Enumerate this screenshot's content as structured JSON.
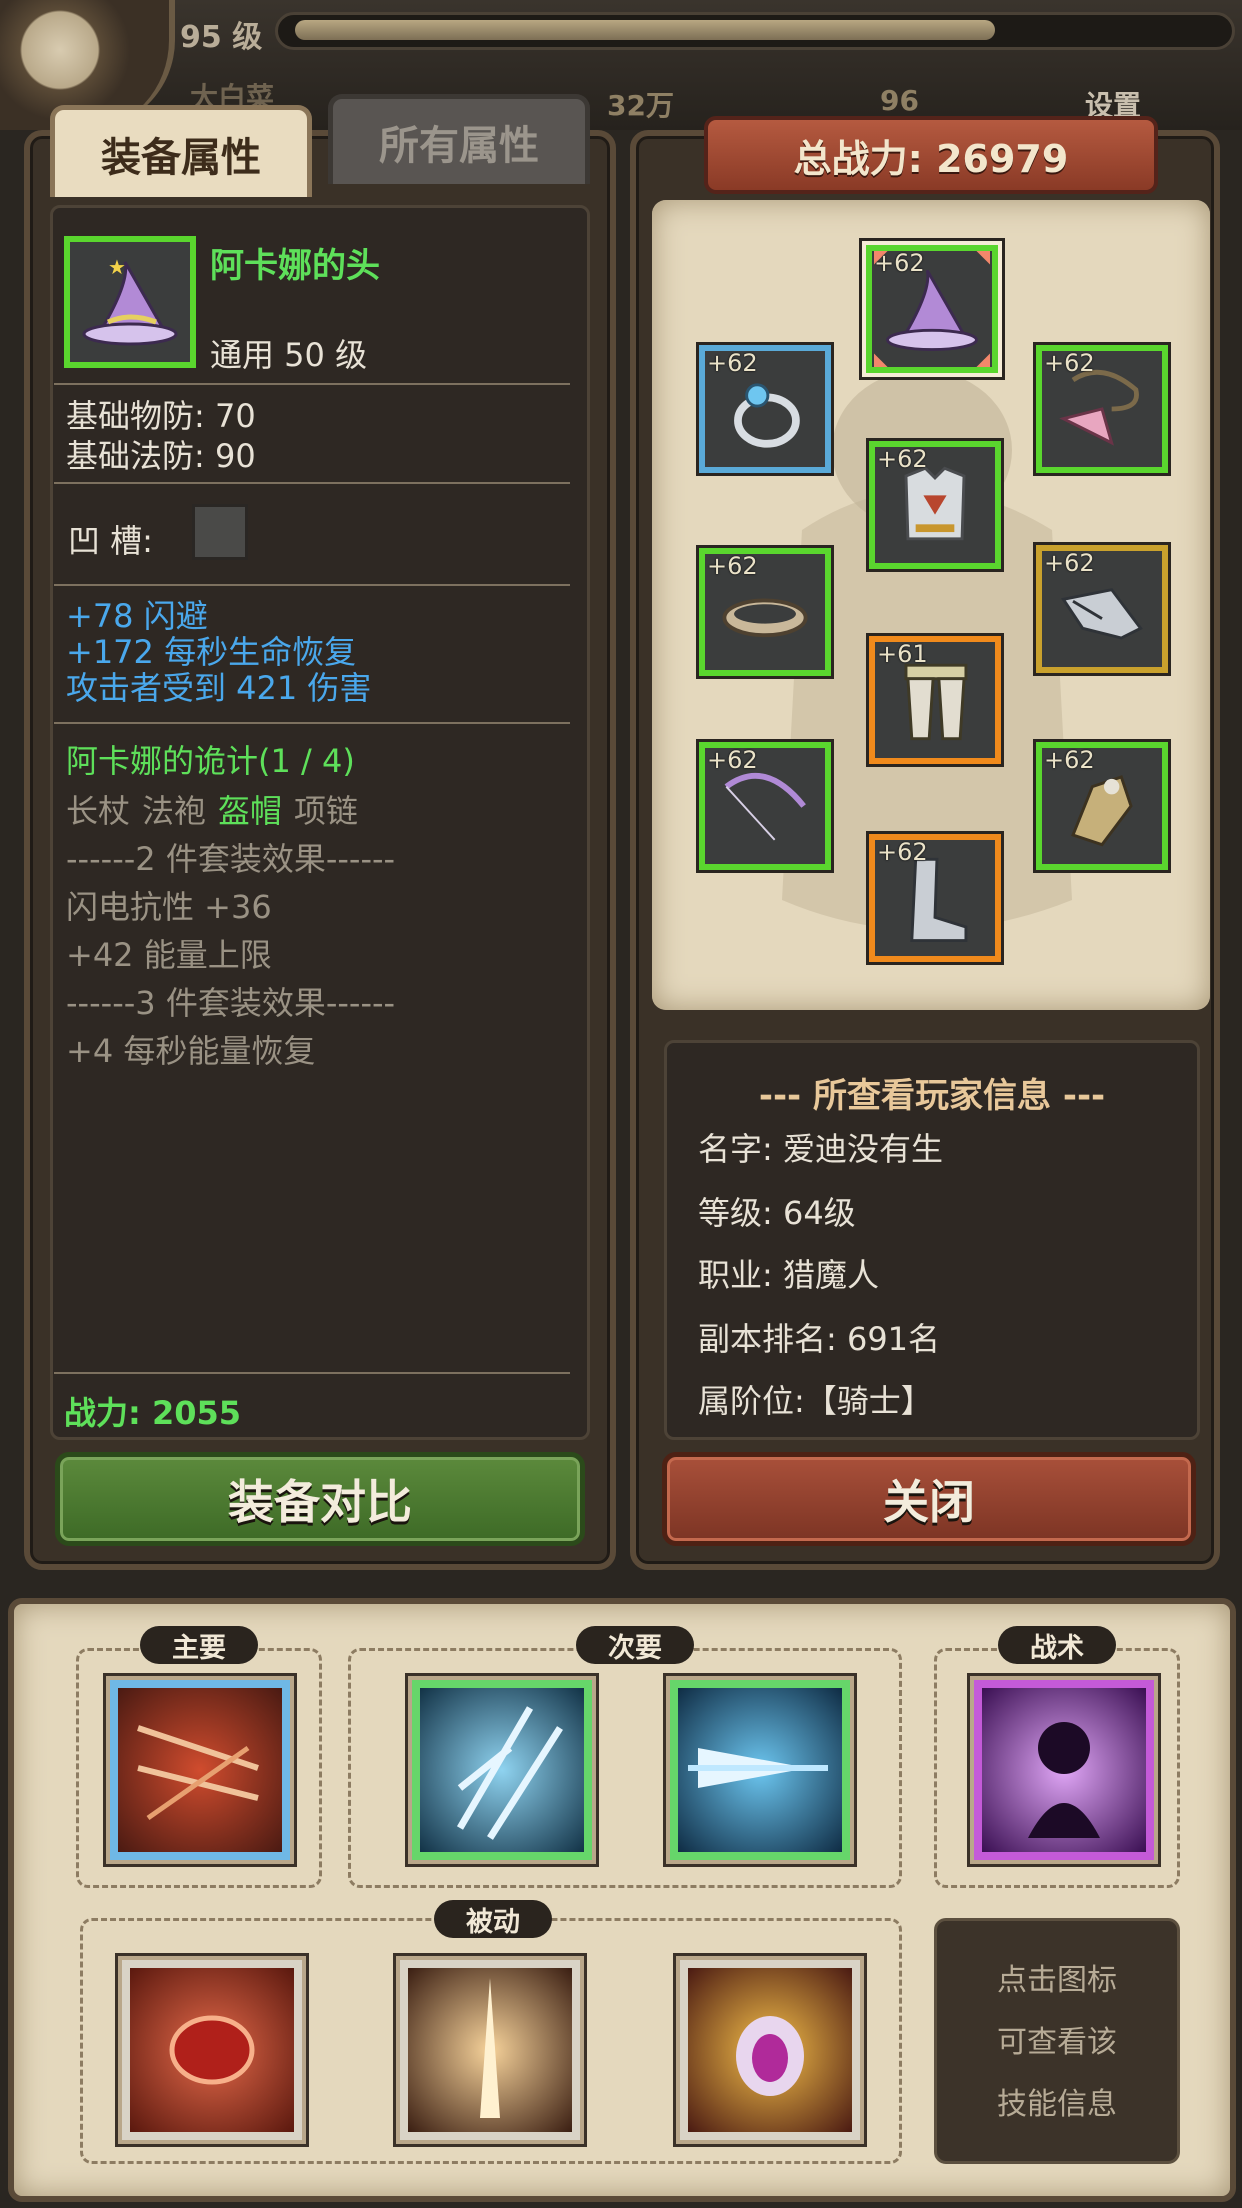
{
  "top": {
    "level": "95 级",
    "name": "大白菜",
    "gold": "32万",
    "gems": "96",
    "settings": "设置"
  },
  "tabs": [
    {
      "label": "装备属性"
    },
    {
      "label": "所有属性"
    }
  ],
  "item": {
    "name": "阿卡娜的头",
    "type_line": "通用  50 级",
    "base": [
      "基础物防:  70",
      "基础法防:  90"
    ],
    "socket_label": "凹    槽:",
    "bonus": [
      "+78 闪避",
      "+172 每秒生命恢复",
      "攻击者受到 421 伤害"
    ],
    "set_name": "阿卡娜的诡计(1 / 4)",
    "set_parts": [
      {
        "text": "长杖",
        "owned": false
      },
      {
        "text": "法袍",
        "owned": false
      },
      {
        "text": "盔帽",
        "owned": true
      },
      {
        "text": "项链",
        "owned": false
      }
    ],
    "set_lines": [
      "------2 件套装效果------",
      "闪电抗性 +36",
      "+42 能量上限",
      "------3 件套装效果------",
      "+4 每秒能量恢复"
    ],
    "power": "战力:  2055"
  },
  "compare_button": "装备对比",
  "total_power": "总战力: 26979",
  "equipment": [
    {
      "slot": "helmet",
      "level": "+62",
      "rarity": "green",
      "icon": "wizard-hat-icon"
    },
    {
      "slot": "ring",
      "level": "+62",
      "rarity": "blue",
      "icon": "ring-icon"
    },
    {
      "slot": "necklace",
      "level": "+62",
      "rarity": "green",
      "icon": "necklace-icon"
    },
    {
      "slot": "armor",
      "level": "+62",
      "rarity": "green",
      "icon": "armor-icon"
    },
    {
      "slot": "belt",
      "level": "+62",
      "rarity": "green",
      "icon": "belt-icon"
    },
    {
      "slot": "gloves",
      "level": "+62",
      "rarity": "yellow",
      "icon": "gauntlet-icon"
    },
    {
      "slot": "pants",
      "level": "+61",
      "rarity": "orange",
      "icon": "pants-icon"
    },
    {
      "slot": "bow",
      "level": "+62",
      "rarity": "green",
      "icon": "bow-icon"
    },
    {
      "slot": "offhand",
      "level": "+62",
      "rarity": "green",
      "icon": "bracer-icon"
    },
    {
      "slot": "boots",
      "level": "+62",
      "rarity": "orange",
      "icon": "boots-icon"
    }
  ],
  "player": {
    "title": "--- 所查看玩家信息 ---",
    "rows": [
      "名字:  爱迪没有生",
      "等级:  64级",
      "职业:  猎魔人",
      "副本排名:  691名",
      "属阶位:【骑士】"
    ]
  },
  "close_button": "关闭",
  "skills": {
    "primary_label": "主要",
    "secondary_label": "次要",
    "tactic_label": "战术",
    "passive_label": "被动",
    "primary": [
      {
        "icon": "arrow-volley-skill-icon",
        "color": "#6fb8e6"
      }
    ],
    "secondary": [
      {
        "icon": "ice-arrows-skill-icon",
        "color": "#66d66a"
      },
      {
        "icon": "piercing-arrow-skill-icon",
        "color": "#66d66a"
      }
    ],
    "tactic": [
      {
        "icon": "shadow-clone-skill-icon",
        "color": "#c45ad8"
      }
    ],
    "passive": [
      {
        "icon": "blood-cell-skill-icon"
      },
      {
        "icon": "light-burst-skill-icon"
      },
      {
        "icon": "demon-eye-skill-icon"
      }
    ],
    "hint": [
      "点击图标",
      "可查看该",
      "技能信息"
    ]
  }
}
